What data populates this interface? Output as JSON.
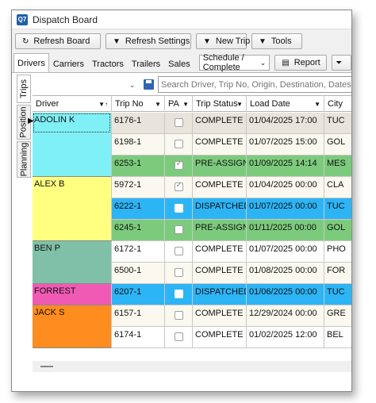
{
  "window": {
    "title": "Dispatch Board",
    "app_icon_text": "Q7"
  },
  "toolbar": {
    "buttons": [
      {
        "label": "Refresh Board",
        "icon": "refresh-icon"
      },
      {
        "label": "Refresh Settings",
        "icon": "dropdown-arrow-icon"
      },
      {
        "label": "New Trip",
        "icon": "dropdown-arrow-icon"
      },
      {
        "label": "Tools",
        "icon": "dropdown-arrow-icon"
      }
    ]
  },
  "tabs": [
    {
      "label": "Drivers",
      "active": true
    },
    {
      "label": "Carriers",
      "active": false
    },
    {
      "label": "Tractors",
      "active": false
    },
    {
      "label": "Trailers",
      "active": false
    },
    {
      "label": "Sales",
      "active": false
    }
  ],
  "view_select": {
    "value": "Schedule / Complete"
  },
  "report_button": {
    "label": "Report"
  },
  "side_tabs": [
    {
      "label": "Trips",
      "active": true
    },
    {
      "label": "Position",
      "active": false
    },
    {
      "label": "Planning",
      "active": false
    }
  ],
  "search": {
    "placeholder": "Search Driver, Trip No, Origin, Destination, Dates, UDFs, and"
  },
  "grid": {
    "columns": [
      "Driver",
      "Trip No",
      "PA",
      "Trip Status",
      "Load Date",
      "City"
    ],
    "rows": [
      {
        "driver": "ADOLIN K",
        "trip": "6176-1",
        "pa": false,
        "status": "COMPLETE",
        "date": "01/04/2025 17:00",
        "city": "TUC"
      },
      {
        "driver": "",
        "trip": "6198-1",
        "pa": false,
        "status": "COMPLETE",
        "date": "01/07/2025 15:00",
        "city": "GOL"
      },
      {
        "driver": "",
        "trip": "6253-1",
        "pa": true,
        "status": "PRE-ASSIGN",
        "date": "01/09/2025 14:14",
        "city": "MES"
      },
      {
        "driver": "ALEX B",
        "trip": "5972-1",
        "pa": true,
        "status": "COMPLETE",
        "date": "01/04/2025 00:00",
        "city": "CLA"
      },
      {
        "driver": "",
        "trip": "6222-1",
        "pa": false,
        "status": "DISPATCHED",
        "date": "01/07/2025 00:00",
        "city": "TUC"
      },
      {
        "driver": "",
        "trip": "6245-1",
        "pa": false,
        "status": "PRE-ASSIGN",
        "date": "01/11/2025 00:00",
        "city": "GOL"
      },
      {
        "driver": "BEN P",
        "trip": "6172-1",
        "pa": false,
        "status": "COMPLETE",
        "date": "01/07/2025 00:00",
        "city": "PHO"
      },
      {
        "driver": "",
        "trip": "6500-1",
        "pa": false,
        "status": "COMPLETE",
        "date": "01/08/2025 00:00",
        "city": "FOR"
      },
      {
        "driver": "FORREST",
        "trip": "6207-1",
        "pa": false,
        "status": "DISPATCHED",
        "date": "01/06/2025 00:00",
        "city": "TUC"
      },
      {
        "driver": "JACK S",
        "trip": "6157-1",
        "pa": false,
        "status": "COMPLETE",
        "date": "12/29/2024 00:00",
        "city": "GRE"
      },
      {
        "driver": "",
        "trip": "6174-1",
        "pa": false,
        "status": "COMPLETE",
        "date": "01/02/2025 12:00",
        "city": "BEL"
      }
    ]
  },
  "colors": {
    "adolin": "#7ff0f6",
    "alex": "#ffff80",
    "ben": "#80c0a8",
    "forrest": "#f05ab4",
    "jack": "#ff8c1e",
    "pre_assign": "#7ccb7c",
    "dispatched": "#2db4f5",
    "complete_light": "#fbf8ef",
    "complete_alt": "#ffffff",
    "selected_row": "#e8e4dc"
  }
}
